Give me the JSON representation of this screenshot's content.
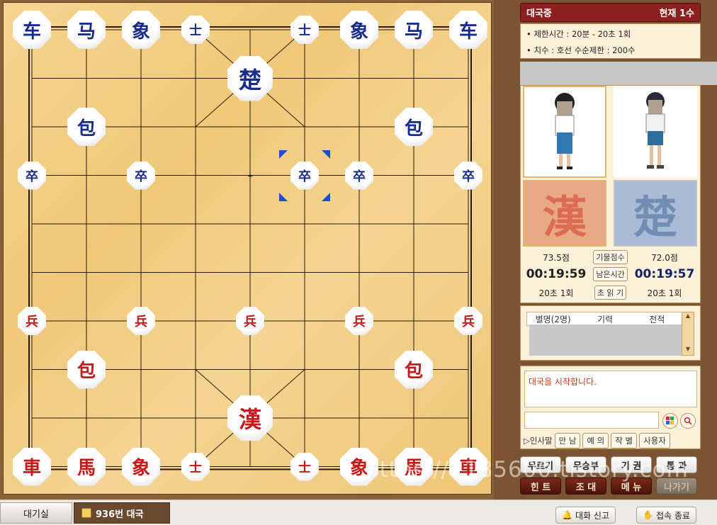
{
  "status": {
    "title": "대국중",
    "move": "현재 1수"
  },
  "rules": {
    "time_limit": "• 제한시간 : 20분 - 20초 1회",
    "handicap": "• 치수 : 호선 수순제한 : 200수"
  },
  "players": {
    "han_mark": "漢",
    "cho_mark": "楚",
    "left_score": "73.5점",
    "right_score": "72.0점",
    "score_label": "기물점수",
    "left_time": "00:19:59",
    "right_time": "00:19:57",
    "time_label": "남은시간",
    "left_byoyomi": "20초 1회",
    "right_byoyomi": "20초 1회",
    "byoyomi_label": "초 읽 기"
  },
  "spectators": {
    "headers": [
      "별명(2명)",
      "기력",
      "전적"
    ]
  },
  "chat": {
    "log": "대국을 시작합니다.",
    "greeting_label": "▷인사말",
    "greetings": [
      "만 남",
      "예 의",
      "작 별",
      "사용자"
    ]
  },
  "actions": {
    "row1": [
      "무르기",
      "무승부",
      "기 권",
      "통 과"
    ],
    "row2": [
      "힌 트",
      "조 대",
      "메 뉴",
      "나가기"
    ]
  },
  "watermark": "https://1185600.tistory.com",
  "bottom": {
    "lobby_tab": "대기실",
    "game_tab": "936번 대국",
    "report": "대화 신고",
    "exit": "접속 종료"
  },
  "pieces": {
    "blue": [
      {
        "char": "车",
        "size": "mid"
      },
      {
        "char": "马",
        "size": "mid"
      },
      {
        "char": "象",
        "size": "mid"
      },
      {
        "char": "士",
        "size": "small"
      },
      {
        "char": "士",
        "size": "small"
      },
      {
        "char": "象",
        "size": "mid"
      },
      {
        "char": "马",
        "size": "mid"
      },
      {
        "char": "车",
        "size": "mid"
      },
      {
        "char": "楚",
        "size": "big"
      },
      {
        "char": "包",
        "size": "mid"
      },
      {
        "char": "包",
        "size": "mid"
      },
      {
        "char": "卒",
        "size": "small"
      },
      {
        "char": "卒",
        "size": "small"
      },
      {
        "char": "卒",
        "size": "small"
      },
      {
        "char": "卒",
        "size": "small"
      },
      {
        "char": "卒",
        "size": "small"
      }
    ],
    "red": [
      {
        "char": "兵",
        "size": "small"
      },
      {
        "char": "兵",
        "size": "small"
      },
      {
        "char": "兵",
        "size": "small"
      },
      {
        "char": "兵",
        "size": "small"
      },
      {
        "char": "兵",
        "size": "small"
      },
      {
        "char": "包",
        "size": "mid"
      },
      {
        "char": "包",
        "size": "mid"
      },
      {
        "char": "漢",
        "size": "big"
      },
      {
        "char": "車",
        "size": "mid"
      },
      {
        "char": "馬",
        "size": "mid"
      },
      {
        "char": "象",
        "size": "mid"
      },
      {
        "char": "士",
        "size": "small"
      },
      {
        "char": "士",
        "size": "small"
      },
      {
        "char": "象",
        "size": "mid"
      },
      {
        "char": "馬",
        "size": "mid"
      },
      {
        "char": "車",
        "size": "mid"
      }
    ]
  }
}
